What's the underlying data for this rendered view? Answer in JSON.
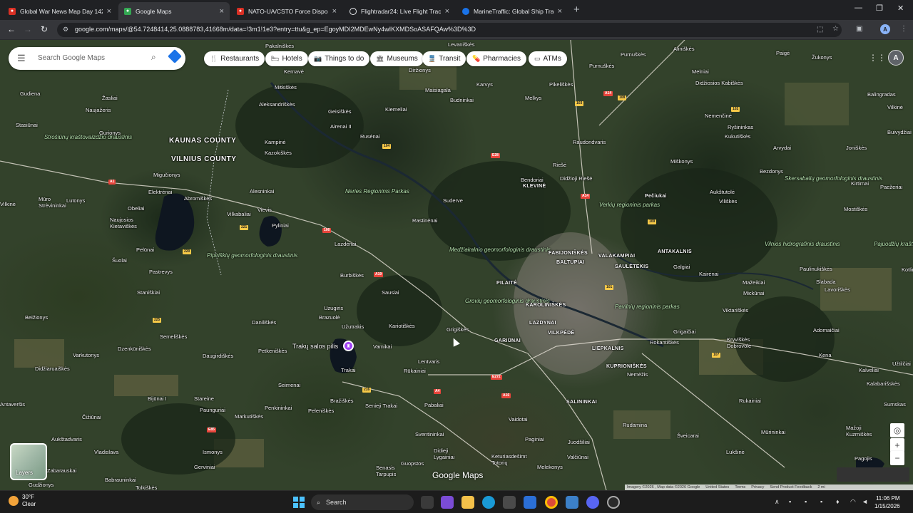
{
  "browser": {
    "tabs": [
      {
        "title": "Global War News Map Day 142",
        "favicon": "map-pin-icon",
        "active": false
      },
      {
        "title": "Google Maps",
        "favicon": "google-maps-icon",
        "active": true
      },
      {
        "title": "NATO-UA/CSTO Force Dispositi",
        "favicon": "map-pin-icon",
        "active": false
      },
      {
        "title": "Flightradar24: Live Flight Tracke",
        "favicon": "radar-icon",
        "active": false
      },
      {
        "title": "MarineTraffic: Global Ship Track",
        "favicon": "ship-icon",
        "active": false
      }
    ],
    "url": "google.com/maps/@54.7248414,25.0888783,41668m/data=!3m1!1e3?entry=ttu&g_ep=EgoyMDI2MDEwNy4wIKXMDSoASAFQAw%3D%3D",
    "profile_initial": "A"
  },
  "maps": {
    "search_placeholder": "Search Google Maps",
    "chips": [
      {
        "label": "Restaurants",
        "icon": "fork-knife-icon"
      },
      {
        "label": "Hotels",
        "icon": "bed-icon"
      },
      {
        "label": "Things to do",
        "icon": "camera-icon"
      },
      {
        "label": "Museums",
        "icon": "museum-icon"
      },
      {
        "label": "Transit",
        "icon": "train-icon"
      },
      {
        "label": "Pharmacies",
        "icon": "pharmacy-icon"
      },
      {
        "label": "ATMs",
        "icon": "atm-icon"
      }
    ],
    "avatar_initial": "A",
    "layers_label": "Layers",
    "logo": "Google Maps",
    "pin_poi": "Trakų salos pilis",
    "attribution": [
      "Imagery ©2026 , Map data ©2026 Google",
      "United States",
      "Terms",
      "Privacy",
      "Send Product Feedback",
      "2 mi"
    ],
    "places": [
      {
        "name": "Pakalniškės"
      },
      {
        "name": "Kernavė"
      },
      {
        "name": "Diržionys"
      },
      {
        "name": "Levaniškės"
      },
      {
        "name": "Purnuškės"
      },
      {
        "name": "Aliniškės"
      },
      {
        "name": "Paigė"
      },
      {
        "name": "Žukonys"
      },
      {
        "name": "Gudiena"
      },
      {
        "name": "Mitkiškės"
      },
      {
        "name": "Maisiagala"
      },
      {
        "name": "Karvys"
      },
      {
        "name": "Melniai"
      },
      {
        "name": "Didžiosios Kabiškės"
      },
      {
        "name": "Balingradas"
      },
      {
        "name": "Žasliai"
      },
      {
        "name": "Naujažeris"
      },
      {
        "name": "Aleksandriškės"
      },
      {
        "name": "Geisiškės"
      },
      {
        "name": "Kiemeliai"
      },
      {
        "name": "Budninkai"
      },
      {
        "name": "Melkys"
      },
      {
        "name": "Pikeliškės"
      },
      {
        "name": "Purnuškės"
      },
      {
        "name": "Vilkinė"
      },
      {
        "name": "Stasiūnai"
      },
      {
        "name": "Gurionys"
      },
      {
        "name": "Airenai II"
      },
      {
        "name": "Nemenčinė"
      },
      {
        "name": "Ryšininkas"
      },
      {
        "name": "Kukutiškės"
      },
      {
        "name": "Rusėnai"
      },
      {
        "name": "Raudondvaris"
      },
      {
        "name": "Buivydžiai"
      },
      {
        "name": "Kampinė"
      },
      {
        "name": "Arvydai"
      },
      {
        "name": "Joniškės"
      },
      {
        "name": "Kazokiškės"
      },
      {
        "name": "Riešė"
      },
      {
        "name": "Miškonys"
      },
      {
        "name": "Migučionys"
      },
      {
        "name": "Bendoriai"
      },
      {
        "name": "Didžioji Riešė"
      },
      {
        "name": "Bezdonys"
      },
      {
        "name": "Elektrėnai"
      },
      {
        "name": "Alesninkai"
      },
      {
        "name": "KLEVINĖ"
      },
      {
        "name": "Aukštutolė"
      },
      {
        "name": "Kirtimai"
      },
      {
        "name": "Paežeriai"
      },
      {
        "name": "Abromiškės"
      },
      {
        "name": "Pečiukai"
      },
      {
        "name": "Lutonys"
      },
      {
        "name": "Viliškės"
      },
      {
        "name": "Mūro Strėvininkai"
      },
      {
        "name": "Vievis"
      },
      {
        "name": "Suderve"
      },
      {
        "name": "Mostiškės"
      },
      {
        "name": "Vilkabaliai"
      },
      {
        "name": "Naujosios Kietaviškės"
      },
      {
        "name": "Pyliniai"
      },
      {
        "name": "Rastinėnai"
      },
      {
        "name": "Obeliai"
      },
      {
        "name": "Lazdėnai"
      },
      {
        "name": "FABIJONIŠKĖS"
      },
      {
        "name": "Pelūnai"
      },
      {
        "name": "VALAKAMPIAI"
      },
      {
        "name": "ANTAKALNIS"
      },
      {
        "name": "BALTUPIAI"
      },
      {
        "name": "Šuolai"
      },
      {
        "name": "Pastrevys"
      },
      {
        "name": "Burbiškės"
      },
      {
        "name": "SAULĖTEKIS"
      },
      {
        "name": "Galgiai"
      },
      {
        "name": "Kairėnai"
      },
      {
        "name": "Paulinukiškės"
      },
      {
        "name": "PILAITĖ"
      },
      {
        "name": "Mažeikiai"
      },
      {
        "name": "Slabada"
      },
      {
        "name": "Lavoriškės"
      },
      {
        "name": "Staniškiai"
      },
      {
        "name": "Sausiai"
      },
      {
        "name": "Mickūnai"
      },
      {
        "name": "KAROLINIŠKĖS"
      },
      {
        "name": "Uzugiris"
      },
      {
        "name": "Viktariškės"
      },
      {
        "name": "Beižionys"
      },
      {
        "name": "Brazuolė"
      },
      {
        "name": "LAZDYNAI"
      },
      {
        "name": "Daniliškės"
      },
      {
        "name": "Kariotiškės"
      },
      {
        "name": "Užutrakis"
      },
      {
        "name": "Grigiškės"
      },
      {
        "name": "VILKPĖDĖ"
      },
      {
        "name": "Grigaičiai"
      },
      {
        "name": "Adomaičiai"
      },
      {
        "name": "Semeliškės"
      },
      {
        "name": "GARIŪNAI"
      },
      {
        "name": "Rokantiškės"
      },
      {
        "name": "Kryviškės Dobrovolė"
      },
      {
        "name": "Dzenkūniškės"
      },
      {
        "name": "Vamikai"
      },
      {
        "name": "Petkeniškės"
      },
      {
        "name": "LIEPKALNIS"
      },
      {
        "name": "Daugirdiškės"
      },
      {
        "name": "Varkutonys"
      },
      {
        "name": "KUPRIONIŠKĖS"
      },
      {
        "name": "Kena"
      },
      {
        "name": "Didžiaruaiškės"
      },
      {
        "name": "Lentvaris"
      },
      {
        "name": "Kalveliai"
      },
      {
        "name": "Trakai"
      },
      {
        "name": "Rūkainiai"
      },
      {
        "name": "Nemėžis"
      },
      {
        "name": "Užtilčiai"
      },
      {
        "name": "Seimenai"
      },
      {
        "name": "Kalabarišskės"
      },
      {
        "name": "Bijūnai I"
      },
      {
        "name": "Stareine"
      },
      {
        "name": "Bražiškės"
      },
      {
        "name": "Senieji Trakai"
      },
      {
        "name": "Rukainiai"
      },
      {
        "name": "Penkininkai"
      },
      {
        "name": "Pabaliai"
      },
      {
        "name": "SALININKAI"
      },
      {
        "name": "Antaveršis"
      },
      {
        "name": "Paunguriai"
      },
      {
        "name": "Peleniškės"
      },
      {
        "name": "Sumskas"
      },
      {
        "name": "Čižiūnai"
      },
      {
        "name": "Markutiškės"
      },
      {
        "name": "Vaidotai"
      },
      {
        "name": "Rudamina"
      },
      {
        "name": "Mūrininkai"
      },
      {
        "name": "Aukštadvaris"
      },
      {
        "name": "Sventininkai"
      },
      {
        "name": "Paginiai"
      },
      {
        "name": "Juodšiliai"
      },
      {
        "name": "Šveicarai"
      },
      {
        "name": "Mažoji Kuzmiškės"
      },
      {
        "name": "Vladislava"
      },
      {
        "name": "Ismonys"
      },
      {
        "name": "Didieji Lygainiai"
      },
      {
        "name": "Valčiūnai"
      },
      {
        "name": "Lukšinė"
      },
      {
        "name": "Pagojis"
      },
      {
        "name": "Zabarauskai"
      },
      {
        "name": "Gerviniai"
      },
      {
        "name": "Keturiasdešimt Totorių"
      },
      {
        "name": "Guopstos"
      },
      {
        "name": "Melekonys"
      },
      {
        "name": "Senasis Tarpupis"
      },
      {
        "name": "Babrauninkai"
      },
      {
        "name": "Gudžionys"
      },
      {
        "name": "Tolkiškės"
      },
      {
        "name": "Kotlinė"
      },
      {
        "name": "Vilkinė"
      }
    ],
    "parks": [
      "Strošiūnų kraštovaizdžio draustinis",
      "Neries Regioninis Parkas",
      "Verkių regioninis parkas",
      "Skersabalių geomorfologinis draustinis",
      "Pipiriškių geomorfologinis draustinis",
      "Medžiakalnio geomorfologinis draustinis",
      "Vilnios hidrografinis draustinis",
      "Pavilnių regioninis parkas",
      "Grovių geomorfologinis draustinis",
      "Pajuodžių kraštovaizdžio draustinis"
    ],
    "counties": [
      "KAUNAS COUNTY",
      "VILNIUS COUNTY"
    ],
    "routes": [
      "A14",
      "108",
      "102",
      "103",
      "104",
      "106",
      "A1",
      "E85",
      "E28",
      "E272",
      "A4",
      "A16",
      "A19",
      "114",
      "216",
      "221",
      "220",
      "225",
      "107",
      "101",
      "109"
    ]
  },
  "taskbar": {
    "weather_temp": "30°F",
    "weather_cond": "Clear",
    "search_label": "Search",
    "time": "11:06 PM",
    "date": "1/15/2026"
  }
}
